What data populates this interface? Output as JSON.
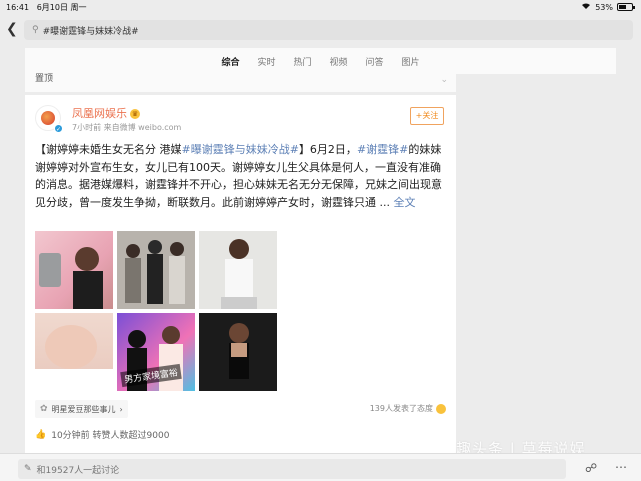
{
  "status": {
    "time": "16:41",
    "date": "6月10日 周一",
    "battery": "53%",
    "battery_level": 0.53
  },
  "search": {
    "query": "#曝谢霆锋与妹妹冷战#"
  },
  "tabs": [
    "综合",
    "实时",
    "热门",
    "视频",
    "问答",
    "图片"
  ],
  "active_tab": 0,
  "pinned_label": "置顶",
  "post": {
    "username": "凤凰网娱乐",
    "meta": "7小时前  来自微博 weibo.com",
    "follow_label": "+关注",
    "text_parts": [
      {
        "t": "【谢婷婷未婚生女无名分 港媒",
        "h": false
      },
      {
        "t": "#曝谢霆锋与妹妹冷战#",
        "h": true
      },
      {
        "t": "】6月2日，",
        "h": false
      },
      {
        "t": "#谢霆锋#",
        "h": true
      },
      {
        "t": "的妹妹谢婷婷对外宣布生女，女儿已有100天。谢婷婷女儿生父具体是何人，一直没有准确的消息。据港媒爆料，谢霆锋并不开心，担心妹妹无名无分无保障，兄妹之间出现意见分歧，曾一度发生争拗，断联数月。此前谢婷婷产女时，谢霆锋只通 ... ",
        "h": false
      },
      {
        "t": "全文",
        "h": true
      }
    ],
    "photo_overlay_label": "男方家境富裕",
    "tag": "明星爱豆那些事儿",
    "attitudes": "139人发表了态度",
    "likes": "10分钟前 转赞人数超过9000"
  },
  "watermark": "趣头条 | 草莓说娱",
  "bottom": {
    "discuss_placeholder": "和19527人一起讨论"
  }
}
